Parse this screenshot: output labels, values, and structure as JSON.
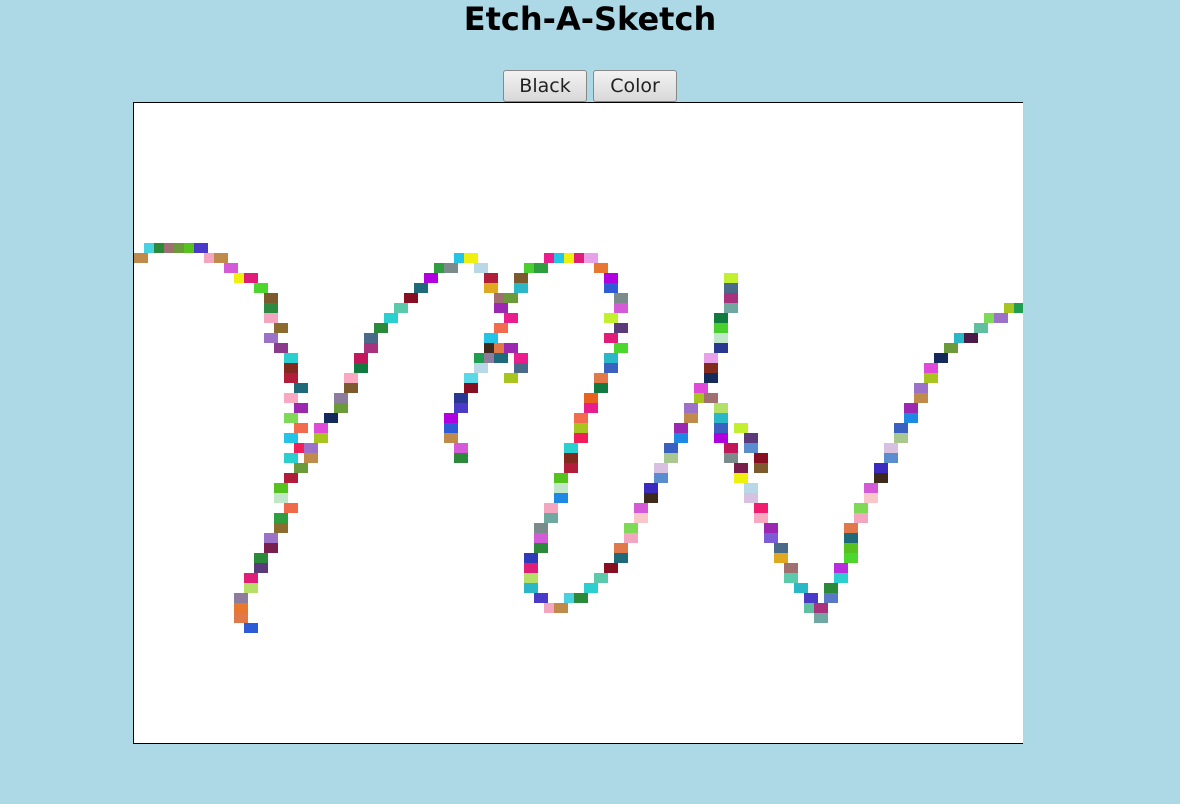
{
  "title": "Etch-A-Sketch",
  "buttons": {
    "black_label": "Black",
    "color_label": "Color"
  },
  "colors": {
    "background": "#add8e6",
    "board": "#ffffff"
  }
}
